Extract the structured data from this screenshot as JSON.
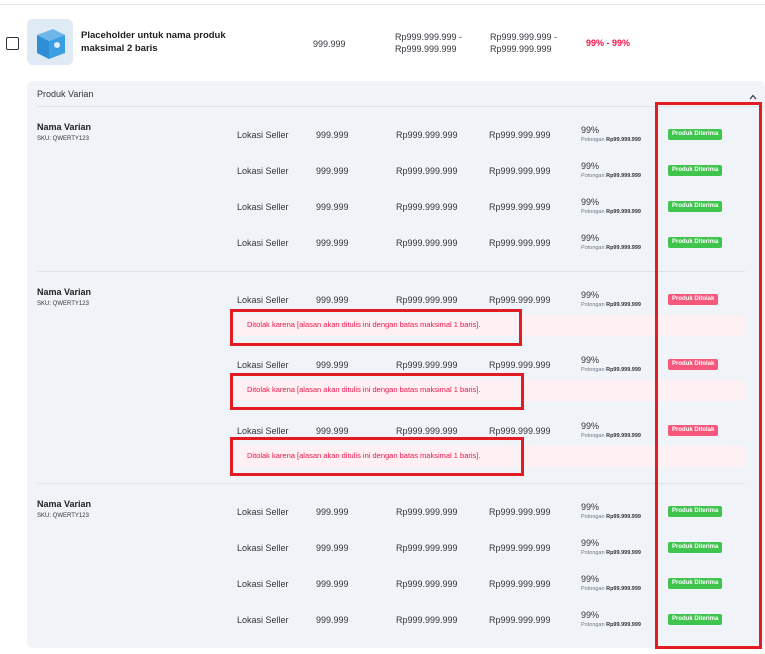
{
  "product": {
    "name": "Placeholder untuk nama produk maksimal 2 baris",
    "stock": "999.999",
    "price_range_1": "Rp999.999.999 -\nRp999.999.999",
    "price_range_2": "Rp999.999.999 -\nRp999.999.999",
    "discount_range": "99% - 99%"
  },
  "panel": {
    "title": "Produk Varian"
  },
  "variant_groups": [
    {
      "name": "Nama Varian",
      "sku": "SKU: QWERTY123",
      "rows": [
        {
          "location": "Lokasi Seller",
          "stock": "999.999",
          "price": "Rp999.999.999",
          "final_price": "Rp999.999.999",
          "discount": "99%",
          "cut_label": "Potongan",
          "cut_value": "Rp99.999.999",
          "status": "Produk Diterima"
        },
        {
          "location": "Lokasi Seller",
          "stock": "999.999",
          "price": "Rp999.999.999",
          "final_price": "Rp999.999.999",
          "discount": "99%",
          "cut_label": "Potongan",
          "cut_value": "Rp99.999.999",
          "status": "Produk Diterima"
        },
        {
          "location": "Lokasi Seller",
          "stock": "999.999",
          "price": "Rp999.999.999",
          "final_price": "Rp999.999.999",
          "discount": "99%",
          "cut_label": "Potongan",
          "cut_value": "Rp99.999.999",
          "status": "Produk Diterima"
        },
        {
          "location": "Lokasi Seller",
          "stock": "999.999",
          "price": "Rp999.999.999",
          "final_price": "Rp999.999.999",
          "discount": "99%",
          "cut_label": "Potongan",
          "cut_value": "Rp99.999.999",
          "status": "Produk Diterima"
        }
      ]
    },
    {
      "name": "Nama Varian",
      "sku": "SKU: QWERTY123",
      "rows": [
        {
          "location": "Lokasi Seller",
          "stock": "999.999",
          "price": "Rp999.999.999",
          "final_price": "Rp999.999.999",
          "discount": "99%",
          "cut_label": "Potongan",
          "cut_value": "Rp99.999.999",
          "status": "Produk Ditolak",
          "reason": "Ditolak karena [alasan akan ditulis ini dengan batas maksimal 1 baris]."
        },
        {
          "location": "Lokasi Seller",
          "stock": "999.999",
          "price": "Rp999.999.999",
          "final_price": "Rp999.999.999",
          "discount": "99%",
          "cut_label": "Potongan",
          "cut_value": "Rp99.999.999",
          "status": "Produk Ditolak",
          "reason": "Ditolak karena [alasan akan ditulis ini dengan batas maksimal 1 baris]."
        },
        {
          "location": "Lokasi Seller",
          "stock": "999.999",
          "price": "Rp999.999.999",
          "final_price": "Rp999.999.999",
          "discount": "99%",
          "cut_label": "Potongan",
          "cut_value": "Rp99.999.999",
          "status": "Produk Ditolak",
          "reason": "Ditolak karena [alasan akan ditulis ini dengan batas maksimal 1 baris]."
        }
      ]
    },
    {
      "name": "Nama Varian",
      "sku": "SKU: QWERTY123",
      "rows": [
        {
          "location": "Lokasi Seller",
          "stock": "999.999",
          "price": "Rp999.999.999",
          "final_price": "Rp999.999.999",
          "discount": "99%",
          "cut_label": "Potongan",
          "cut_value": "Rp99.999.999",
          "status": "Produk Diterima"
        },
        {
          "location": "Lokasi Seller",
          "stock": "999.999",
          "price": "Rp999.999.999",
          "final_price": "Rp999.999.999",
          "discount": "99%",
          "cut_label": "Potongan",
          "cut_value": "Rp99.999.999",
          "status": "Produk Diterima"
        },
        {
          "location": "Lokasi Seller",
          "stock": "999.999",
          "price": "Rp999.999.999",
          "final_price": "Rp999.999.999",
          "discount": "99%",
          "cut_label": "Potongan",
          "cut_value": "Rp99.999.999",
          "status": "Produk Diterima"
        },
        {
          "location": "Lokasi Seller",
          "stock": "999.999",
          "price": "Rp999.999.999",
          "final_price": "Rp999.999.999",
          "discount": "99%",
          "cut_label": "Potongan",
          "cut_value": "Rp99.999.999",
          "status": "Produk Diterima"
        }
      ]
    }
  ],
  "colors": {
    "accepted": "#3fc44e",
    "rejected": "#f5587b",
    "highlight": "#e31b23",
    "discount": "#ef144a"
  }
}
